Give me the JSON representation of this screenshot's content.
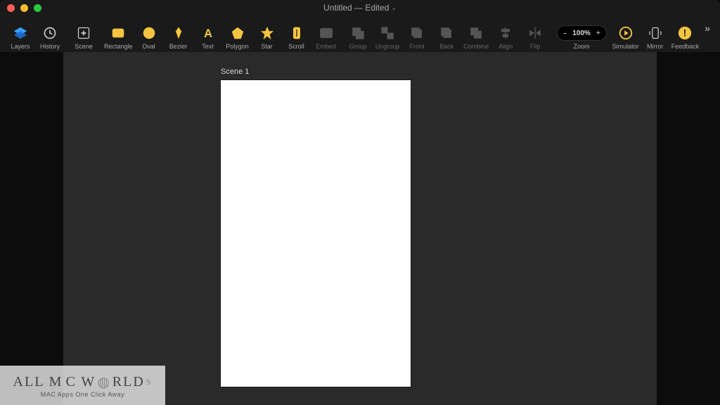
{
  "title": "Untitled — Edited",
  "toolbar": {
    "layers": "Layers",
    "history": "History",
    "scene": "Scene",
    "rectangle": "Rectangle",
    "oval": "Oval",
    "bezier": "Bezier",
    "text": "Text",
    "polygon": "Polygon",
    "star": "Star",
    "scroll": "Scroll",
    "embed": "Embed",
    "group": "Group",
    "ungroup": "Ungroup",
    "front": "Front",
    "back": "Back",
    "combine": "Combine",
    "align": "Align",
    "flip": "Flip",
    "zoom_label": "Zoom",
    "zoom_value": "100%",
    "zoom_minus": "–",
    "zoom_plus": "+",
    "simulator": "Simulator",
    "mirror": "Mirror",
    "feedback": "Feedback"
  },
  "scene": {
    "label": "Scene 1"
  },
  "watermark": {
    "line1a": "ALL M",
    "line1b": "C W",
    "line1c": "RLD",
    "suffix": "S",
    "line2": "MAC Apps One Click Away"
  }
}
